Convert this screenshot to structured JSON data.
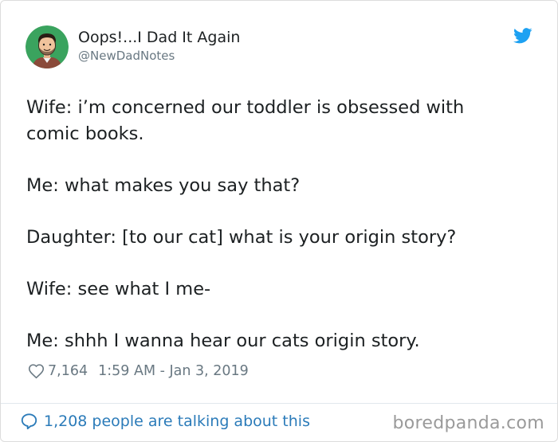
{
  "author": {
    "display_name": "Oops!...I Dad It Again",
    "handle": "@NewDadNotes",
    "avatar_icon": "cartoon-man-avatar",
    "avatar_bg": "#3aa35e"
  },
  "brand_icon": "twitter-bird-icon",
  "brand_color": "#1da1f2",
  "tweet": {
    "paragraphs": [
      "Wife: i’m concerned our toddler is obsessed with comic books.",
      "Me: what makes you say that?",
      "Daughter: [to our cat] what is your origin story?",
      "Wife: see what I me-",
      "Me: shhh I wanna hear our cats origin story."
    ],
    "likes": "7,164",
    "timestamp": "1:59 AM - Jan 3, 2019"
  },
  "footer": {
    "talking": "1,208 people are talking about this",
    "link_color": "#2b7bb9",
    "watermark": "boredpanda.com"
  }
}
